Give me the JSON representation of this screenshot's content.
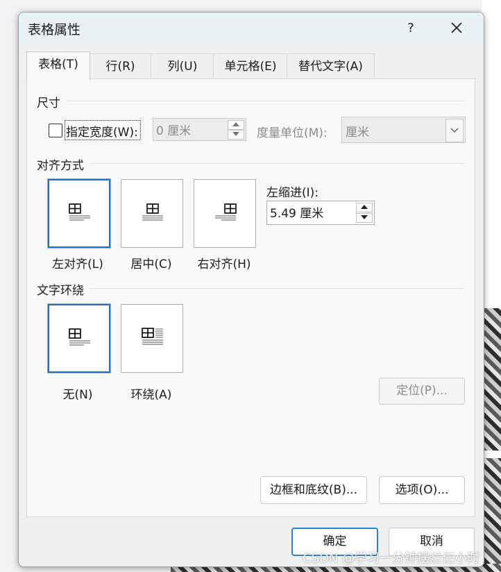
{
  "dialog": {
    "title": "表格属性",
    "help_label": "?",
    "close_icon": "close-icon"
  },
  "tabs": [
    {
      "label": "表格(T)",
      "active": true
    },
    {
      "label": "行(R)"
    },
    {
      "label": "列(U)"
    },
    {
      "label": "单元格(E)"
    },
    {
      "label": "替代文字(A)"
    }
  ],
  "size": {
    "section_title": "尺寸",
    "specify_width_label": "指定宽度(W):",
    "specify_width_checked": false,
    "width_value": "0 厘米",
    "unit_label": "度量单位(M):",
    "unit_value": "厘米"
  },
  "alignment": {
    "section_title": "对齐方式",
    "options": [
      {
        "label": "左对齐(L)",
        "selected": true
      },
      {
        "label": "居中(C)"
      },
      {
        "label": "右对齐(H)"
      }
    ],
    "indent_label": "左缩进(I):",
    "indent_value": "5.49 厘米"
  },
  "wrapping": {
    "section_title": "文字环绕",
    "options": [
      {
        "label": "无(N)",
        "selected": true
      },
      {
        "label": "环绕(A)"
      }
    ],
    "position_button": "定位(P)..."
  },
  "buttons": {
    "borders_shading": "边框和底纹(B)...",
    "options": "选项(O)...",
    "ok": "确定",
    "cancel": "取消"
  },
  "watermark": "CSDN @学习一分钟摆烂仨小时",
  "colors": {
    "accent": "#1b73c8",
    "title_bar": "#e9f3f5"
  }
}
